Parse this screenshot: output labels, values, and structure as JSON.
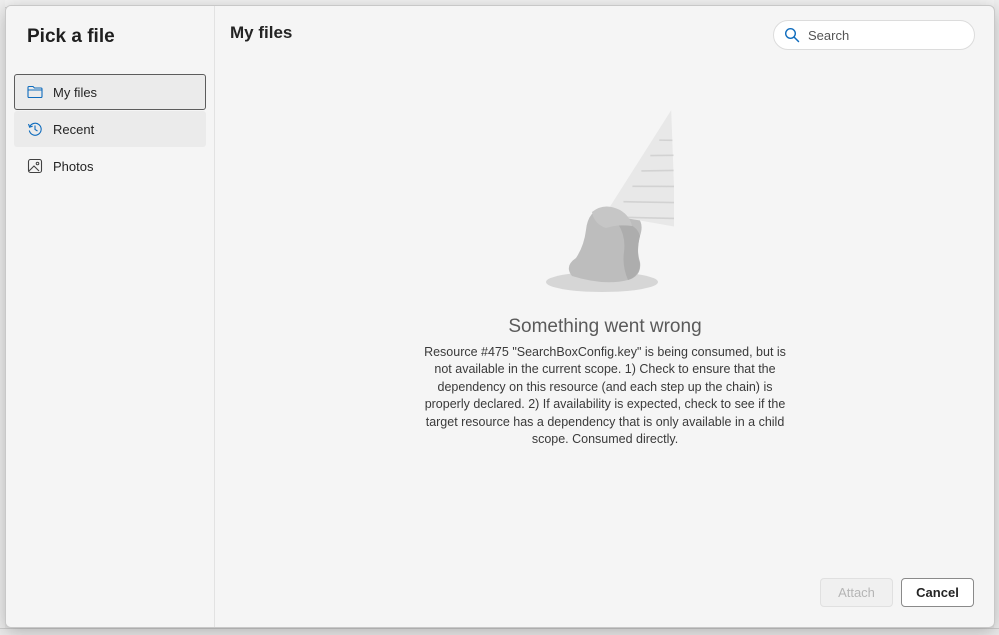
{
  "dialog": {
    "title": "Pick a file"
  },
  "sidebar": {
    "items": [
      {
        "label": "My files",
        "icon": "folder-icon",
        "state": "selected"
      },
      {
        "label": "Recent",
        "icon": "history-icon",
        "state": "hover"
      },
      {
        "label": "Photos",
        "icon": "image-icon",
        "state": "normal"
      }
    ]
  },
  "main": {
    "title": "My files",
    "search": {
      "placeholder": "Search",
      "value": "",
      "icon": "search-icon"
    },
    "error": {
      "illustration": "melted-ice-cream-cone",
      "title": "Something went wrong",
      "message": "Resource #475 \"SearchBoxConfig.key\" is being consumed, but is not available in the current scope. 1) Check to ensure that the dependency on this resource (and each step up the chain) is properly declared. 2) If availability is expected, check to see if the target resource has a dependency that is only available in a child scope. Consumed directly."
    }
  },
  "footer": {
    "attach_label": "Attach",
    "attach_disabled": true,
    "cancel_label": "Cancel"
  },
  "colors": {
    "accent": "#0f6cbd",
    "dialog_bg": "#f5f5f5",
    "selected_border": "#5c5c5c"
  }
}
